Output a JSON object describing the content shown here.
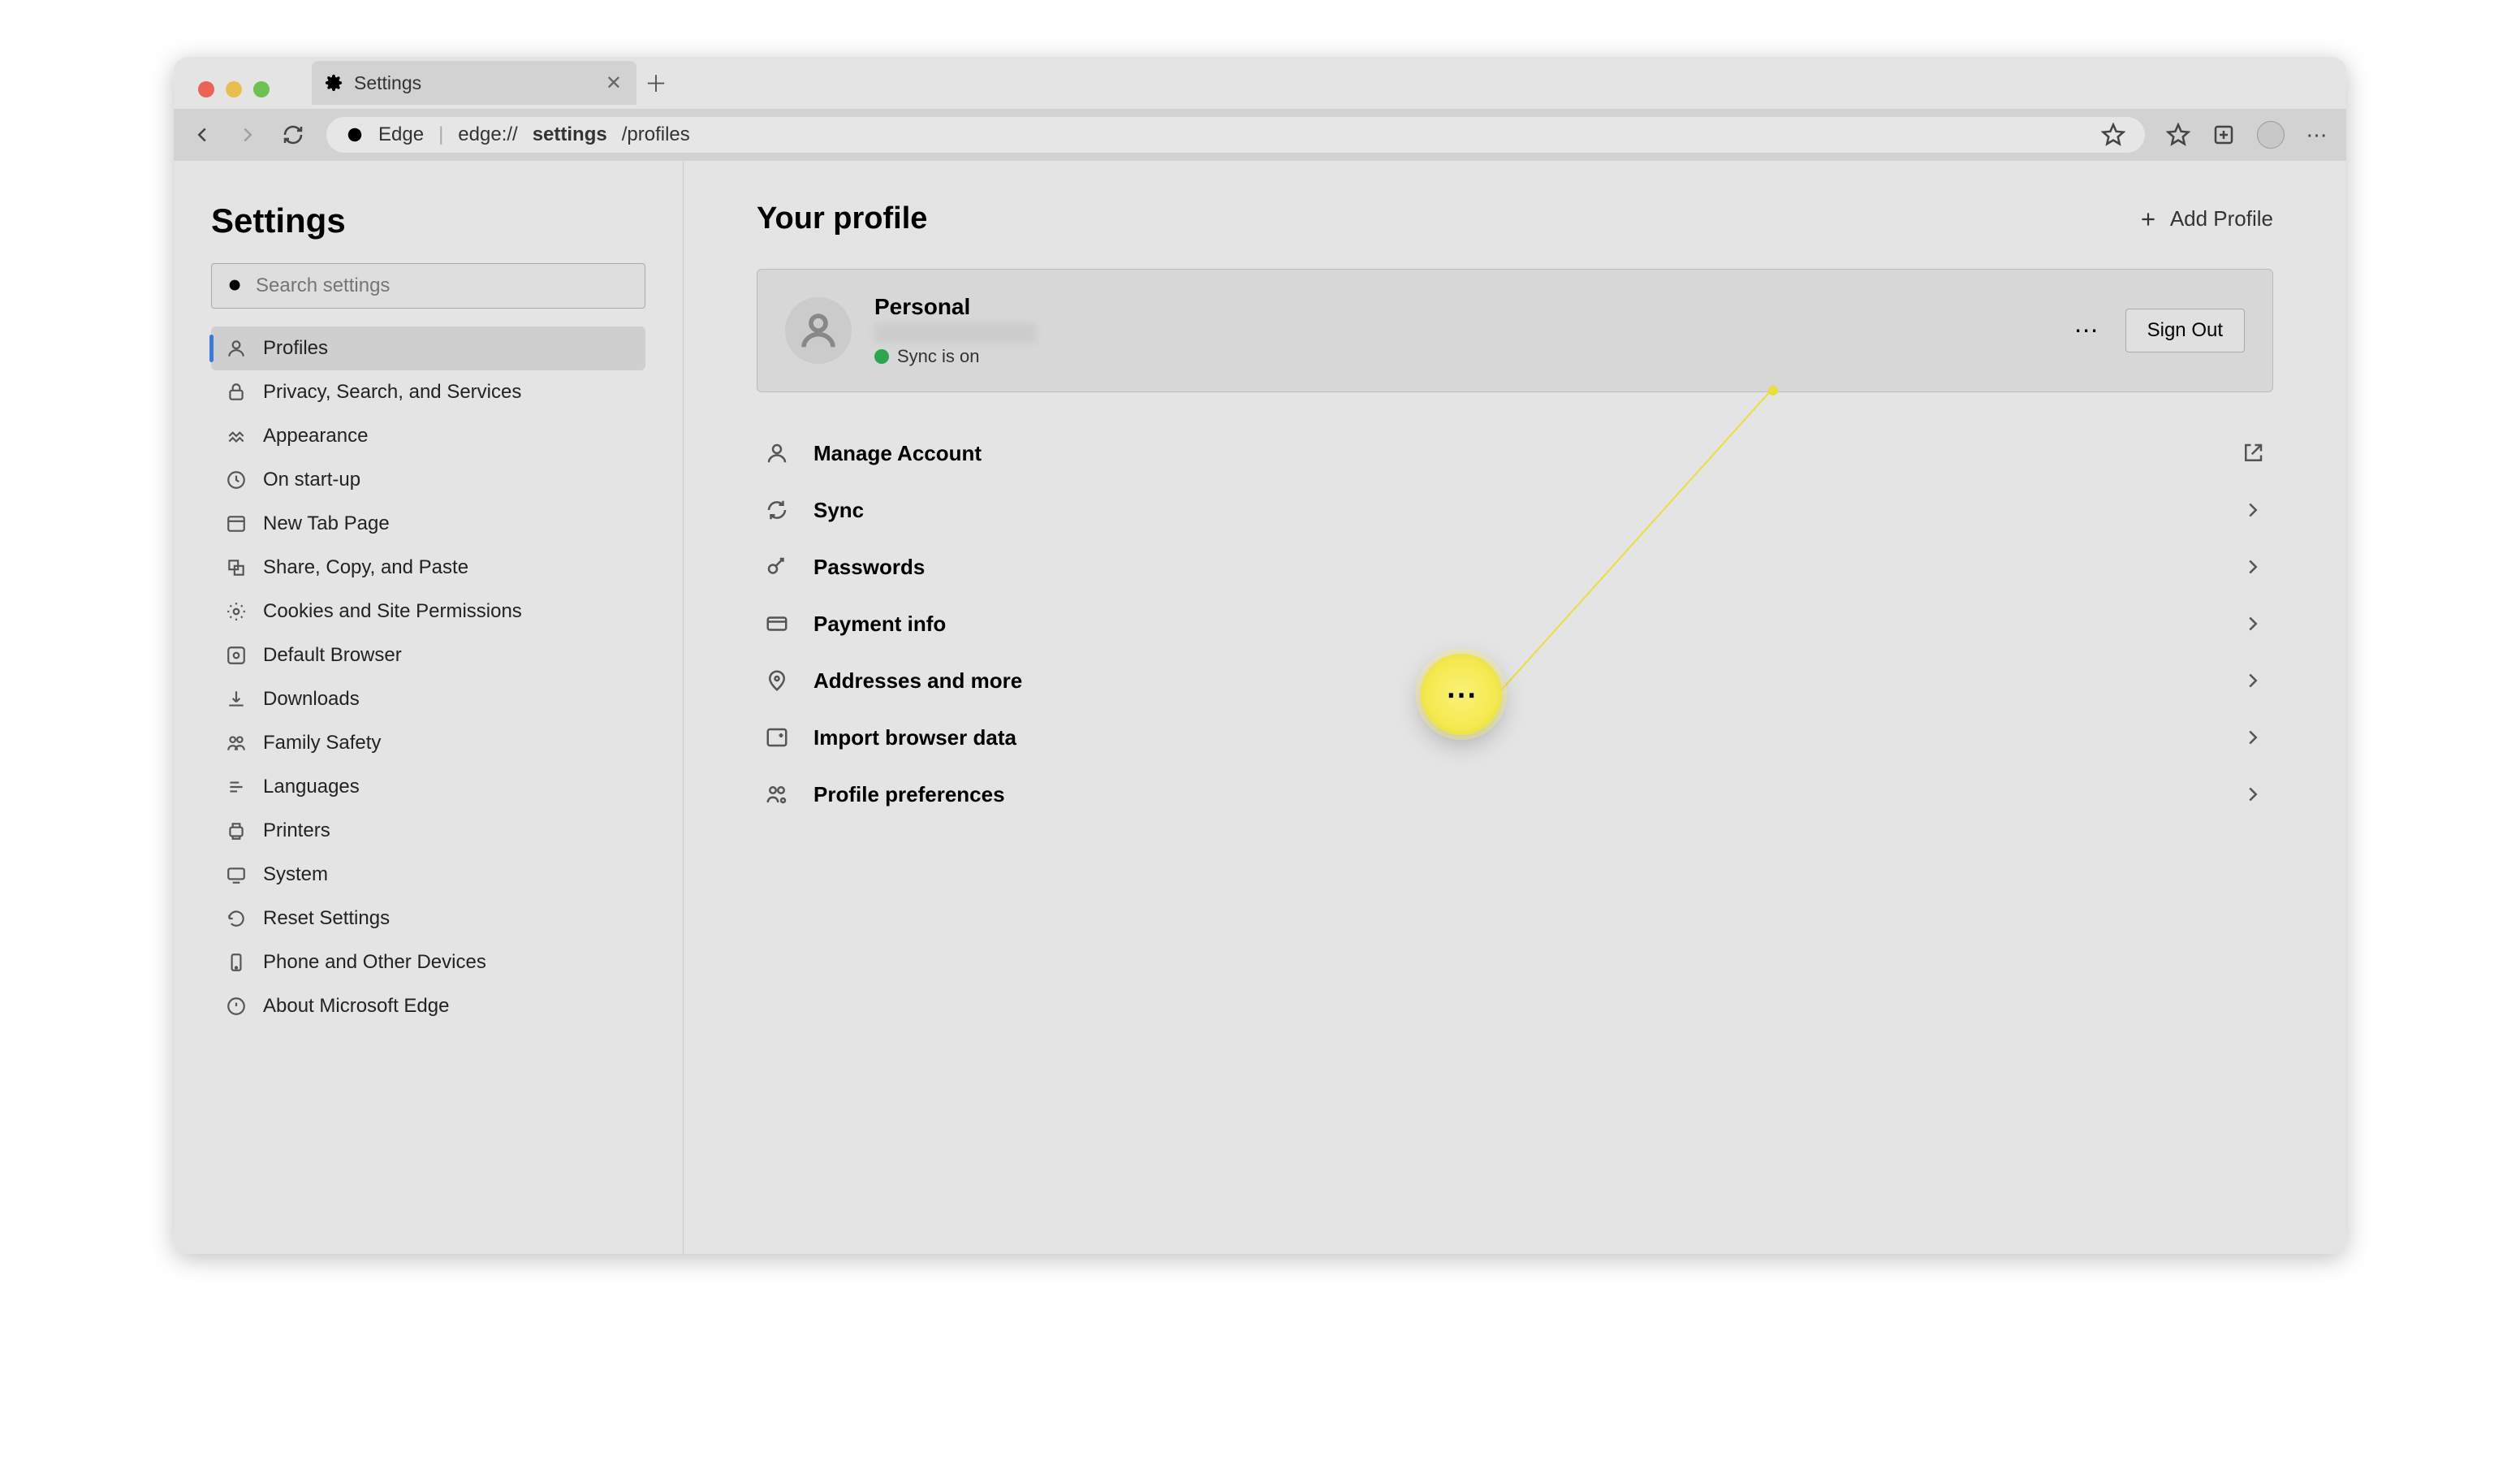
{
  "tab": {
    "title": "Settings"
  },
  "toolbar": {
    "product": "Edge",
    "url_prefix": "edge://",
    "url_bold": "settings",
    "url_suffix": "/profiles"
  },
  "sidebar": {
    "heading": "Settings",
    "search_placeholder": "Search settings",
    "items": [
      "Profiles",
      "Privacy, Search, and Services",
      "Appearance",
      "On start-up",
      "New Tab Page",
      "Share, Copy, and Paste",
      "Cookies and Site Permissions",
      "Default Browser",
      "Downloads",
      "Family Safety",
      "Languages",
      "Printers",
      "System",
      "Reset Settings",
      "Phone and Other Devices",
      "About Microsoft Edge"
    ]
  },
  "main": {
    "heading": "Your profile",
    "add_profile": "Add Profile",
    "profile_name": "Personal",
    "sync_status": "Sync is on",
    "sign_out": "Sign Out",
    "rows": [
      "Manage Account",
      "Sync",
      "Passwords",
      "Payment info",
      "Addresses and more",
      "Import browser data",
      "Profile preferences"
    ]
  }
}
